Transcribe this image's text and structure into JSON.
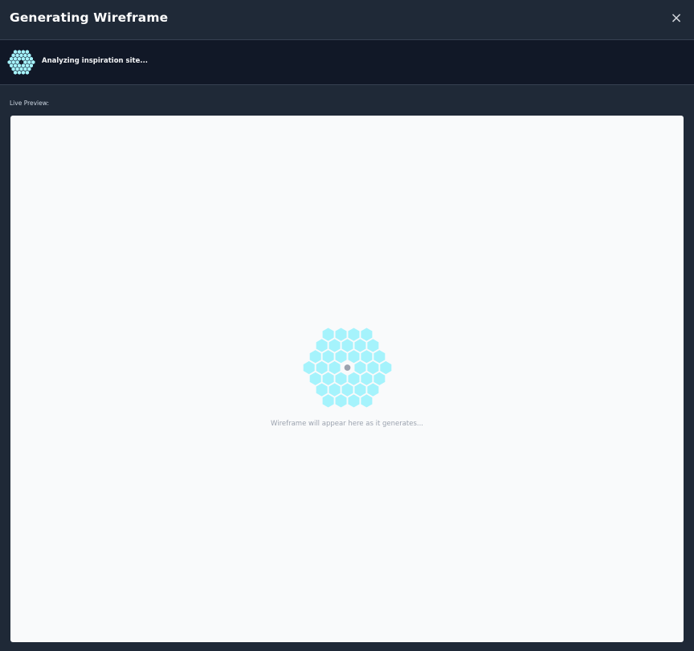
{
  "dialog": {
    "title": "Generating Wireframe",
    "close_label": "×"
  },
  "status": {
    "text": "Analyzing inspiration site...",
    "icon": "hexagon-spinner-icon"
  },
  "preview": {
    "label": "Live Preview:",
    "message": "Wireframe will appear here as it generates...",
    "icon": "hexagon-spinner-icon"
  },
  "colors": {
    "dialog_bg": "#1f2937",
    "status_bg": "#111827",
    "canvas_bg": "#f9fafb",
    "hex_fill": "#a5f3fc",
    "hex_center": "#9ca3af"
  }
}
